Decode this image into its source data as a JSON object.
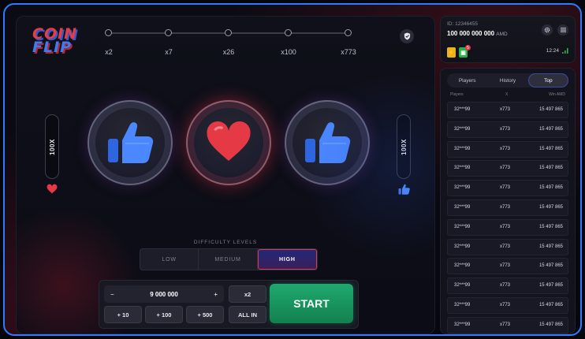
{
  "logo": {
    "line1": "COIN",
    "line2": "FLIP"
  },
  "multipliers": [
    "x2",
    "x7",
    "x26",
    "x100",
    "x773"
  ],
  "side_left": {
    "label": "100X",
    "icon": "heart-icon"
  },
  "side_right": {
    "label": "100X",
    "icon": "thumbs-up-icon"
  },
  "coins": [
    {
      "name": "coin-left",
      "icon": "thumbs-up-icon"
    },
    {
      "name": "coin-center",
      "icon": "heart-icon"
    },
    {
      "name": "coin-right",
      "icon": "thumbs-up-icon"
    }
  ],
  "difficulty": {
    "label": "DIFFICULTY LEVELS",
    "options": [
      "LOW",
      "MEDIUM",
      "HIGH"
    ],
    "selected": "HIGH"
  },
  "bet": {
    "minus": "−",
    "amount": "9 000 000",
    "plus": "+",
    "x2": "x2",
    "plus10": "+ 10",
    "plus100": "+ 100",
    "plus500": "+ 500",
    "all_in": "ALL IN",
    "start": "START"
  },
  "account": {
    "id": "ID: 12346455",
    "balance": "100 000 000 000",
    "currency": "AMD",
    "badge_count": "5",
    "time": "12:24"
  },
  "leaderboard": {
    "tabs": [
      "Players",
      "History",
      "Top"
    ],
    "active_tab": "Top",
    "columns": [
      "Players",
      "X",
      "Win AMD"
    ],
    "rows": [
      {
        "player": "32***99",
        "x": "x773",
        "win": "15 497 865"
      },
      {
        "player": "32***99",
        "x": "x773",
        "win": "15 497 865"
      },
      {
        "player": "32***99",
        "x": "x773",
        "win": "15 497 865"
      },
      {
        "player": "32***99",
        "x": "x773",
        "win": "15 497 865"
      },
      {
        "player": "32***99",
        "x": "x773",
        "win": "15 497 865"
      },
      {
        "player": "32***99",
        "x": "x773",
        "win": "15 497 865"
      },
      {
        "player": "32***99",
        "x": "x773",
        "win": "15 497 865"
      },
      {
        "player": "32***99",
        "x": "x773",
        "win": "15 497 865"
      },
      {
        "player": "32***99",
        "x": "x773",
        "win": "15 497 865"
      },
      {
        "player": "32***99",
        "x": "x773",
        "win": "15 497 865"
      },
      {
        "player": "32***99",
        "x": "x773",
        "win": "15 497 865"
      },
      {
        "player": "32***99",
        "x": "x773",
        "win": "15 497 865"
      }
    ]
  },
  "colors": {
    "accent_blue": "#2f7bff",
    "heart_red": "#e53a46",
    "start_green": "#1fa96f"
  }
}
